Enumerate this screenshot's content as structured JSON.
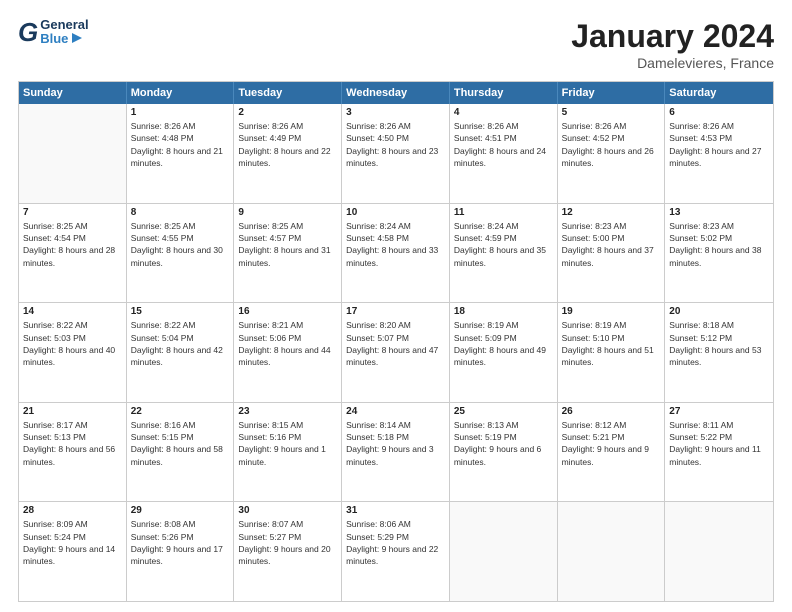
{
  "header": {
    "logo_general": "General",
    "logo_blue": "Blue",
    "month_title": "January 2024",
    "location": "Damelevieres, France"
  },
  "days_of_week": [
    "Sunday",
    "Monday",
    "Tuesday",
    "Wednesday",
    "Thursday",
    "Friday",
    "Saturday"
  ],
  "weeks": [
    [
      {
        "day": "",
        "empty": true
      },
      {
        "day": "1",
        "sunrise": "Sunrise: 8:26 AM",
        "sunset": "Sunset: 4:48 PM",
        "daylight": "Daylight: 8 hours and 21 minutes."
      },
      {
        "day": "2",
        "sunrise": "Sunrise: 8:26 AM",
        "sunset": "Sunset: 4:49 PM",
        "daylight": "Daylight: 8 hours and 22 minutes."
      },
      {
        "day": "3",
        "sunrise": "Sunrise: 8:26 AM",
        "sunset": "Sunset: 4:50 PM",
        "daylight": "Daylight: 8 hours and 23 minutes."
      },
      {
        "day": "4",
        "sunrise": "Sunrise: 8:26 AM",
        "sunset": "Sunset: 4:51 PM",
        "daylight": "Daylight: 8 hours and 24 minutes."
      },
      {
        "day": "5",
        "sunrise": "Sunrise: 8:26 AM",
        "sunset": "Sunset: 4:52 PM",
        "daylight": "Daylight: 8 hours and 26 minutes."
      },
      {
        "day": "6",
        "sunrise": "Sunrise: 8:26 AM",
        "sunset": "Sunset: 4:53 PM",
        "daylight": "Daylight: 8 hours and 27 minutes."
      }
    ],
    [
      {
        "day": "7",
        "sunrise": "Sunrise: 8:25 AM",
        "sunset": "Sunset: 4:54 PM",
        "daylight": "Daylight: 8 hours and 28 minutes."
      },
      {
        "day": "8",
        "sunrise": "Sunrise: 8:25 AM",
        "sunset": "Sunset: 4:55 PM",
        "daylight": "Daylight: 8 hours and 30 minutes."
      },
      {
        "day": "9",
        "sunrise": "Sunrise: 8:25 AM",
        "sunset": "Sunset: 4:57 PM",
        "daylight": "Daylight: 8 hours and 31 minutes."
      },
      {
        "day": "10",
        "sunrise": "Sunrise: 8:24 AM",
        "sunset": "Sunset: 4:58 PM",
        "daylight": "Daylight: 8 hours and 33 minutes."
      },
      {
        "day": "11",
        "sunrise": "Sunrise: 8:24 AM",
        "sunset": "Sunset: 4:59 PM",
        "daylight": "Daylight: 8 hours and 35 minutes."
      },
      {
        "day": "12",
        "sunrise": "Sunrise: 8:23 AM",
        "sunset": "Sunset: 5:00 PM",
        "daylight": "Daylight: 8 hours and 37 minutes."
      },
      {
        "day": "13",
        "sunrise": "Sunrise: 8:23 AM",
        "sunset": "Sunset: 5:02 PM",
        "daylight": "Daylight: 8 hours and 38 minutes."
      }
    ],
    [
      {
        "day": "14",
        "sunrise": "Sunrise: 8:22 AM",
        "sunset": "Sunset: 5:03 PM",
        "daylight": "Daylight: 8 hours and 40 minutes."
      },
      {
        "day": "15",
        "sunrise": "Sunrise: 8:22 AM",
        "sunset": "Sunset: 5:04 PM",
        "daylight": "Daylight: 8 hours and 42 minutes."
      },
      {
        "day": "16",
        "sunrise": "Sunrise: 8:21 AM",
        "sunset": "Sunset: 5:06 PM",
        "daylight": "Daylight: 8 hours and 44 minutes."
      },
      {
        "day": "17",
        "sunrise": "Sunrise: 8:20 AM",
        "sunset": "Sunset: 5:07 PM",
        "daylight": "Daylight: 8 hours and 47 minutes."
      },
      {
        "day": "18",
        "sunrise": "Sunrise: 8:19 AM",
        "sunset": "Sunset: 5:09 PM",
        "daylight": "Daylight: 8 hours and 49 minutes."
      },
      {
        "day": "19",
        "sunrise": "Sunrise: 8:19 AM",
        "sunset": "Sunset: 5:10 PM",
        "daylight": "Daylight: 8 hours and 51 minutes."
      },
      {
        "day": "20",
        "sunrise": "Sunrise: 8:18 AM",
        "sunset": "Sunset: 5:12 PM",
        "daylight": "Daylight: 8 hours and 53 minutes."
      }
    ],
    [
      {
        "day": "21",
        "sunrise": "Sunrise: 8:17 AM",
        "sunset": "Sunset: 5:13 PM",
        "daylight": "Daylight: 8 hours and 56 minutes."
      },
      {
        "day": "22",
        "sunrise": "Sunrise: 8:16 AM",
        "sunset": "Sunset: 5:15 PM",
        "daylight": "Daylight: 8 hours and 58 minutes."
      },
      {
        "day": "23",
        "sunrise": "Sunrise: 8:15 AM",
        "sunset": "Sunset: 5:16 PM",
        "daylight": "Daylight: 9 hours and 1 minute."
      },
      {
        "day": "24",
        "sunrise": "Sunrise: 8:14 AM",
        "sunset": "Sunset: 5:18 PM",
        "daylight": "Daylight: 9 hours and 3 minutes."
      },
      {
        "day": "25",
        "sunrise": "Sunrise: 8:13 AM",
        "sunset": "Sunset: 5:19 PM",
        "daylight": "Daylight: 9 hours and 6 minutes."
      },
      {
        "day": "26",
        "sunrise": "Sunrise: 8:12 AM",
        "sunset": "Sunset: 5:21 PM",
        "daylight": "Daylight: 9 hours and 9 minutes."
      },
      {
        "day": "27",
        "sunrise": "Sunrise: 8:11 AM",
        "sunset": "Sunset: 5:22 PM",
        "daylight": "Daylight: 9 hours and 11 minutes."
      }
    ],
    [
      {
        "day": "28",
        "sunrise": "Sunrise: 8:09 AM",
        "sunset": "Sunset: 5:24 PM",
        "daylight": "Daylight: 9 hours and 14 minutes."
      },
      {
        "day": "29",
        "sunrise": "Sunrise: 8:08 AM",
        "sunset": "Sunset: 5:26 PM",
        "daylight": "Daylight: 9 hours and 17 minutes."
      },
      {
        "day": "30",
        "sunrise": "Sunrise: 8:07 AM",
        "sunset": "Sunset: 5:27 PM",
        "daylight": "Daylight: 9 hours and 20 minutes."
      },
      {
        "day": "31",
        "sunrise": "Sunrise: 8:06 AM",
        "sunset": "Sunset: 5:29 PM",
        "daylight": "Daylight: 9 hours and 22 minutes."
      },
      {
        "day": "",
        "empty": true
      },
      {
        "day": "",
        "empty": true
      },
      {
        "day": "",
        "empty": true
      }
    ]
  ]
}
